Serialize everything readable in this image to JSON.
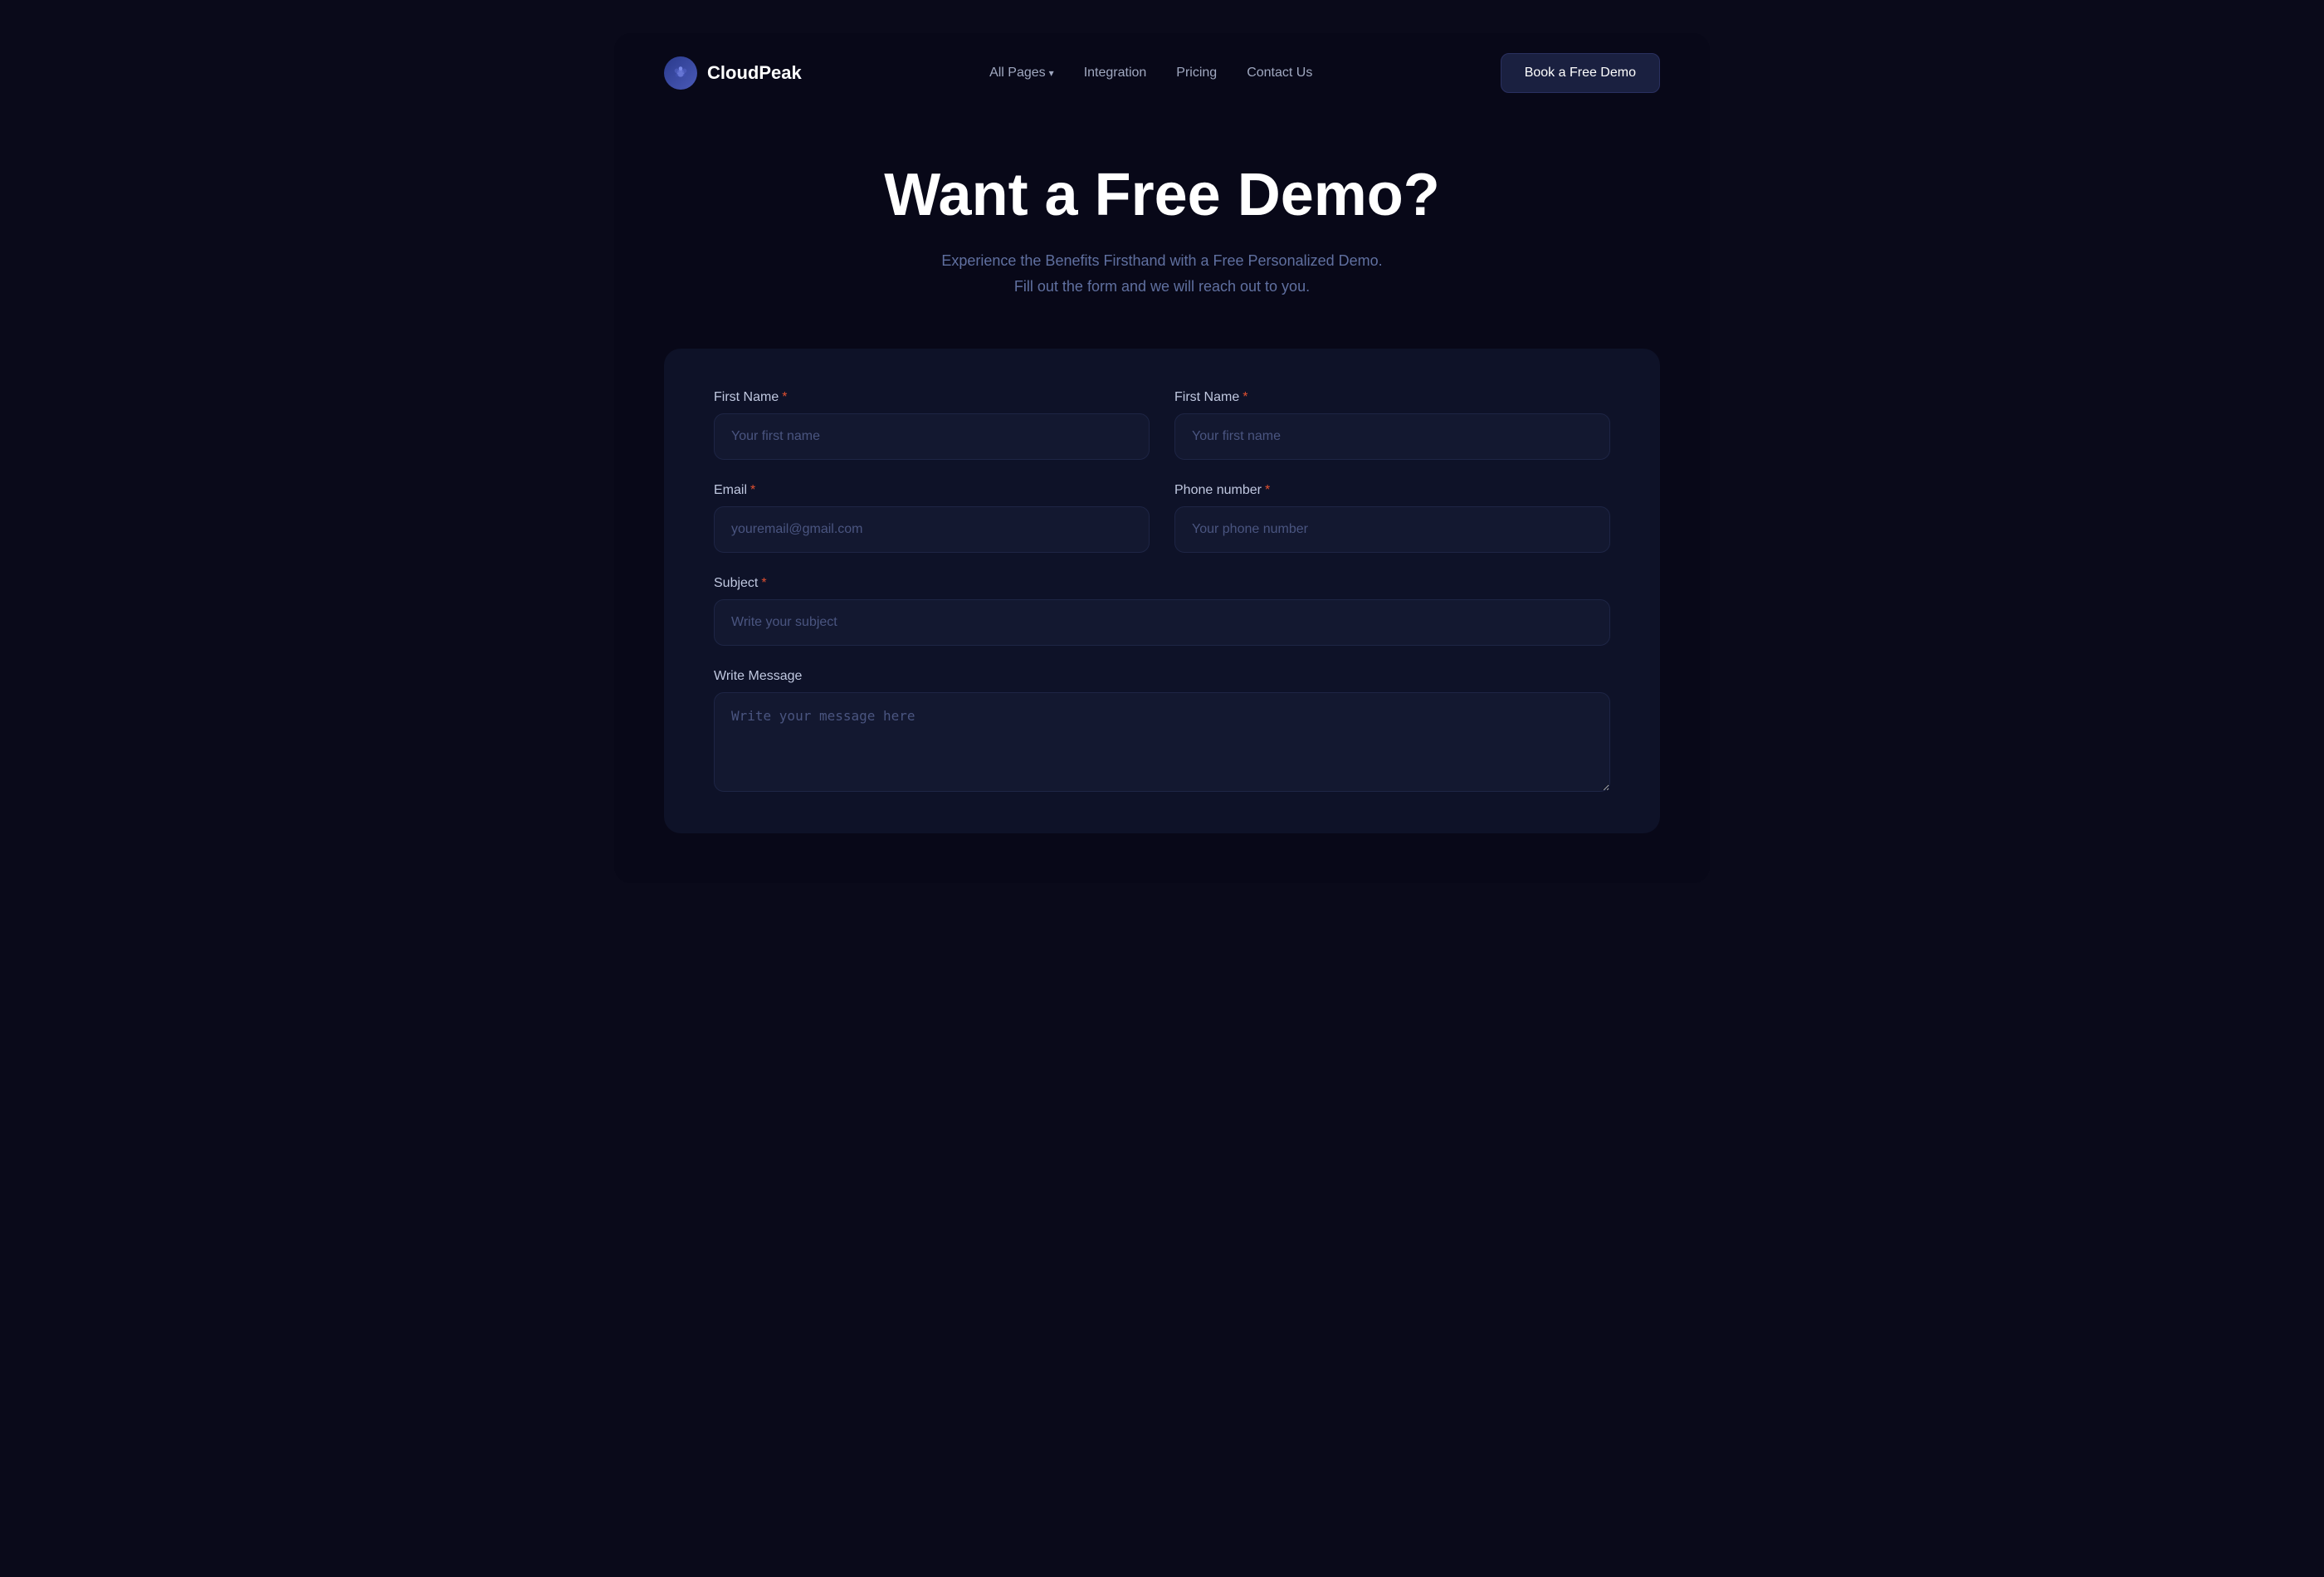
{
  "brand": {
    "logo_text": "CloudPeak",
    "logo_icon": "cloud-peak-icon"
  },
  "nav": {
    "links": [
      {
        "label": "All Pages",
        "has_dropdown": true
      },
      {
        "label": "Integration",
        "has_dropdown": false
      },
      {
        "label": "Pricing",
        "has_dropdown": false
      },
      {
        "label": "Contact Us",
        "has_dropdown": false
      }
    ],
    "cta_label": "Book a Free Demo"
  },
  "hero": {
    "title": "Want a Free Demo?",
    "subtitle_line1": "Experience the Benefits Firsthand with a Free Personalized Demo.",
    "subtitle_line2": "Fill out the form and we will reach out to you."
  },
  "form": {
    "fields": {
      "first_name_left": {
        "label": "First Name",
        "placeholder": "Your first name",
        "required": true
      },
      "first_name_right": {
        "label": "First Name",
        "placeholder": "Your first name",
        "required": true
      },
      "email": {
        "label": "Email",
        "placeholder": "youremail@gmail.com",
        "required": true
      },
      "phone": {
        "label": "Phone number",
        "placeholder": "Your phone number",
        "required": true
      },
      "subject": {
        "label": "Subject",
        "placeholder": "Write your subject",
        "required": true
      },
      "message": {
        "label": "Write Message",
        "placeholder": "Write your message here",
        "required": false
      }
    }
  },
  "colors": {
    "required_star": "#e05030",
    "bg_page": "#080818",
    "bg_form": "#0e1228",
    "bg_input": "#131830",
    "text_primary": "#ffffff",
    "text_secondary": "#6070a0"
  }
}
